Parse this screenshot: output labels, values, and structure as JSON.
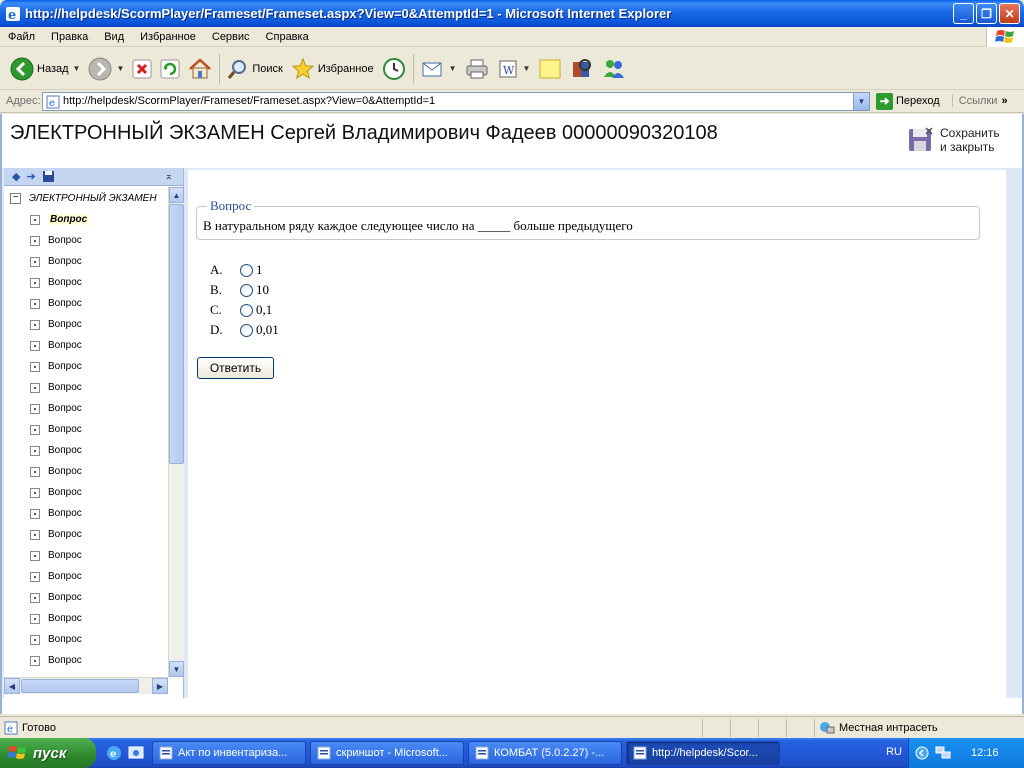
{
  "window": {
    "title": "http://helpdesk/ScormPlayer/Frameset/Frameset.aspx?View=0&AttemptId=1 - Microsoft Internet Explorer"
  },
  "menu": [
    "Файл",
    "Правка",
    "Вид",
    "Избранное",
    "Сервис",
    "Справка"
  ],
  "toolbar": {
    "back_label": "Назад",
    "search_label": "Поиск",
    "favorites_label": "Избранное"
  },
  "address": {
    "label": "Адрес:",
    "url": "http://helpdesk/ScormPlayer/Frameset/Frameset.aspx?View=0&AttemptId=1",
    "go_label": "Переход",
    "links_label": "Ссылки"
  },
  "exam": {
    "title": "ЭЛЕКТРОННЫЙ ЭКЗАМЕН Сергей Владимирович Фадеев 00000090320108",
    "save_close_label": "Сохранить и закрыть"
  },
  "tree": {
    "root_label": "ЭЛЕКТРОННЫЙ ЭКЗАМЕН",
    "items": [
      "Вопрос",
      "Вопрос",
      "Вопрос",
      "Вопрос",
      "Вопрос",
      "Вопрос",
      "Вопрос",
      "Вопрос",
      "Вопрос",
      "Вопрос",
      "Вопрос",
      "Вопрос",
      "Вопрос",
      "Вопрос",
      "Вопрос",
      "Вопрос",
      "Вопрос",
      "Вопрос",
      "Вопрос",
      "Вопрос",
      "Вопрос",
      "Вопрос",
      "Вопрос"
    ],
    "active_index": 0
  },
  "question": {
    "legend": "Вопрос",
    "text": "В натуральном ряду каждое следующее число на _____ больше предыдущего",
    "answers": [
      {
        "letter": "A.",
        "value": "1"
      },
      {
        "letter": "B.",
        "value": "10"
      },
      {
        "letter": "C.",
        "value": "0,1"
      },
      {
        "letter": "D.",
        "value": "0,01"
      }
    ],
    "submit_label": "Ответить"
  },
  "status": {
    "text": "Готово",
    "zone": "Местная интрасеть"
  },
  "taskbar": {
    "start_label": "пуск",
    "tasks": [
      {
        "label": "Акт по инвентариза...",
        "active": false
      },
      {
        "label": "скриншот - Microsoft...",
        "active": false
      },
      {
        "label": "КОМБАТ (5.0.2.27) -...",
        "active": false
      },
      {
        "label": "http://helpdesk/Scor...",
        "active": true
      }
    ],
    "lang": "RU",
    "clock": "12:16"
  }
}
